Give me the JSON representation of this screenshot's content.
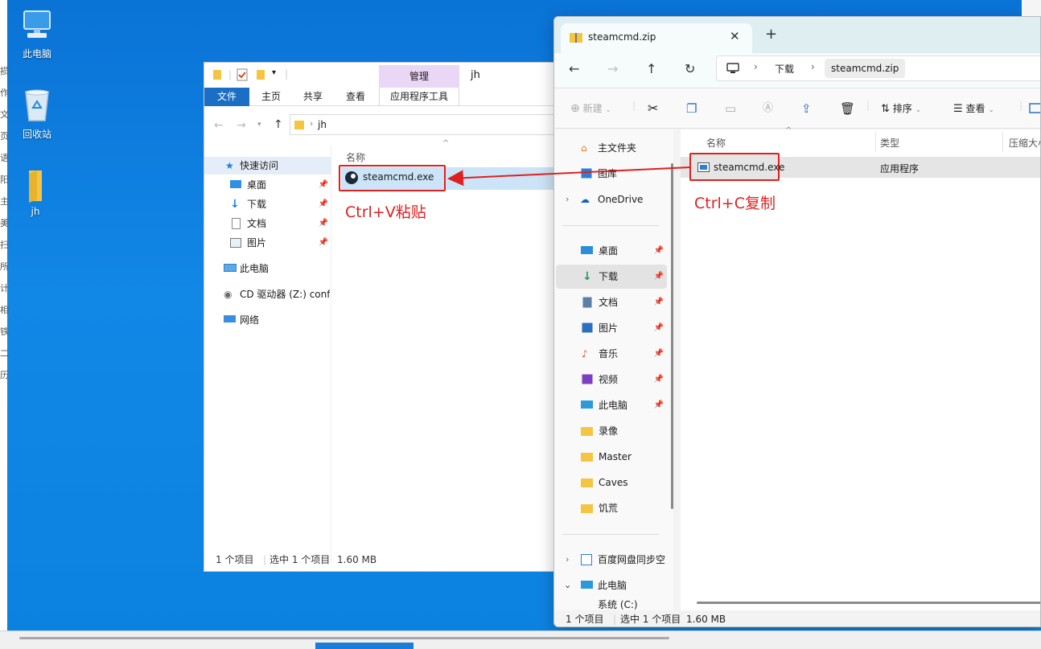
{
  "desktop": {
    "icons": [
      {
        "label": "此电脑",
        "icon": "computer-icon"
      },
      {
        "label": "回收站",
        "icon": "recycle-bin-icon"
      },
      {
        "label": "jh",
        "icon": "folder-icon"
      }
    ],
    "left_strip_chars": [
      "损",
      "作",
      "文",
      "页",
      "语",
      "阳",
      "主",
      "美",
      "扫",
      "所",
      "计",
      "相",
      "铁",
      "二",
      "历"
    ]
  },
  "old_explorer": {
    "title": "jh",
    "manage_label": "管理",
    "tabs": [
      "文件",
      "主页",
      "共享",
      "查看",
      "应用程序工具"
    ],
    "path": "jh",
    "column_name": "名称",
    "nav": {
      "quick_access": "快速访问",
      "items": [
        "桌面",
        "下载",
        "文档",
        "图片"
      ],
      "this_pc": "此电脑",
      "cd_drive": "CD 驱动器 (Z:) confi",
      "network": "网络"
    },
    "file": "steamcmd.exe",
    "status": {
      "count": "1 个项目",
      "selected": "选中 1 个项目",
      "size": "1.60 MB"
    }
  },
  "new_explorer": {
    "tab_title": "steamcmd.zip",
    "breadcrumb": [
      "下载",
      "steamcmd.zip"
    ],
    "commands": {
      "new": "新建",
      "sort": "排序",
      "view": "查看"
    },
    "sidebar": {
      "top": [
        "主文件夹",
        "图库",
        "OneDrive"
      ],
      "pinned": [
        "桌面",
        "下载",
        "文档",
        "图片",
        "音乐",
        "视频",
        "此电脑",
        "录像",
        "Master",
        "Caves",
        "饥荒"
      ],
      "bottom": [
        "百度网盘同步空",
        "此电脑",
        "系统 (C:)"
      ]
    },
    "columns": [
      "名称",
      "类型",
      "压缩大小"
    ],
    "file": {
      "name": "steamcmd.exe",
      "type": "应用程序"
    },
    "status": {
      "count": "1 个项目",
      "selected": "选中 1 个项目",
      "size": "1.60 MB"
    }
  },
  "annotations": {
    "paste": "Ctrl+V粘贴",
    "copy": "Ctrl+C复制",
    "color": "#e02020"
  }
}
